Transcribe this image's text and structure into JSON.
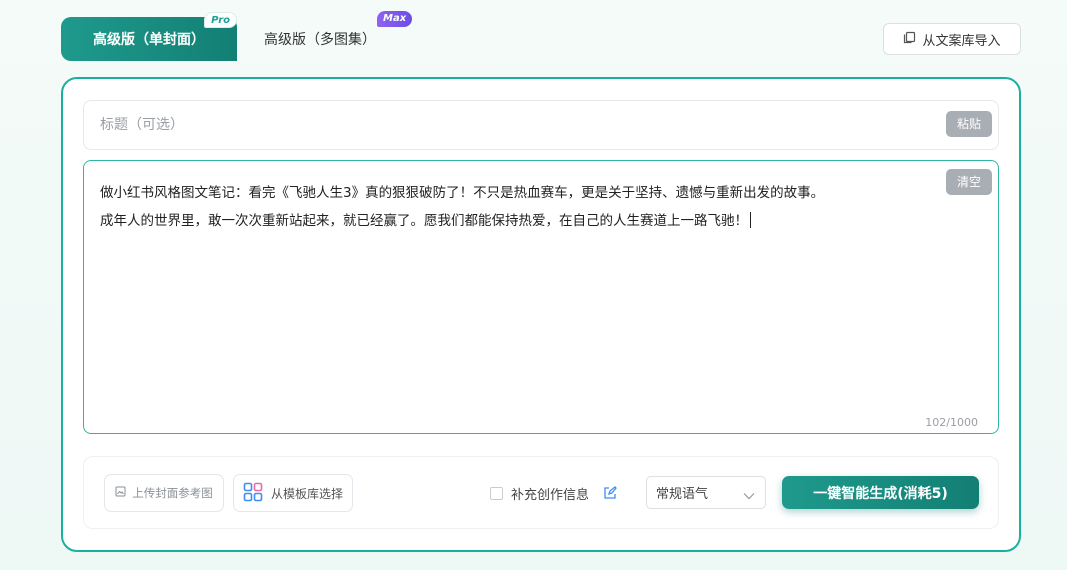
{
  "tabs": {
    "single": {
      "label": "高级版（单封面）",
      "badge": "Pro"
    },
    "multi": {
      "label": "高级版（多图集）",
      "badge": "Max"
    }
  },
  "import_button": {
    "label": "从文案库导入",
    "icon": "copy-icon"
  },
  "title_field": {
    "placeholder": "标题（可选）",
    "value": "",
    "action_label": "粘贴"
  },
  "content_field": {
    "value": "做小红书风格图文笔记：看完《飞驰人生3》真的狠狠破防了！不只是热血赛车，更是关于坚持、遗憾与重新出发的故事。\n成年人的世界里，敢一次次重新站起来，就已经赢了。愿我们都能保持热爱，在自己的人生赛道上一路飞驰！",
    "action_label": "清空",
    "counter": "102/1000"
  },
  "toolbar": {
    "upload_label": "上传封面参考图",
    "template_label": "从模板库选择",
    "supplement_label": "补充创作信息",
    "supplement_checked": false,
    "tone_selected": "常规语气",
    "generate_label": "一键智能生成(消耗5)"
  },
  "colors": {
    "accent": "#1a9a8c",
    "accent_dark": "#137f74",
    "border_accent": "#1ab0a0",
    "max_badge": "#7b58ea",
    "muted_button": "#a9aeb5"
  }
}
